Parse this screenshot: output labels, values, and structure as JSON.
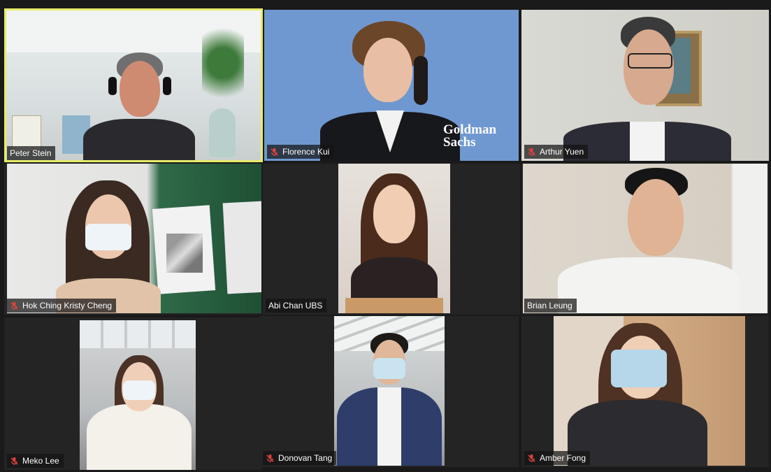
{
  "meeting": {
    "participants": [
      {
        "name": "Peter Stein",
        "muted": false,
        "active_speaker": true
      },
      {
        "name": "Florence Kui",
        "muted": true,
        "active_speaker": false
      },
      {
        "name": "Arthur Yuen",
        "muted": true,
        "active_speaker": false
      },
      {
        "name": "Hok Ching Kristy Cheng",
        "muted": true,
        "active_speaker": false
      },
      {
        "name": "Abi Chan UBS",
        "muted": false,
        "active_speaker": false
      },
      {
        "name": "Brian Leung",
        "muted": false,
        "active_speaker": false
      },
      {
        "name": "Meko Lee",
        "muted": true,
        "active_speaker": false
      },
      {
        "name": "Donovan Tang",
        "muted": true,
        "active_speaker": false
      },
      {
        "name": "Amber Fong",
        "muted": true,
        "active_speaker": false
      }
    ],
    "backgrounds": {
      "goldman_logo_line1": "Goldman",
      "goldman_logo_line2": "Sachs"
    }
  },
  "colors": {
    "active_border": "#e6ec6a",
    "mute_icon": "#e0433e",
    "tile_bg": "#242424",
    "app_bg": "#1a1a1a"
  },
  "icons": {
    "mute": "microphone-muted-icon"
  }
}
